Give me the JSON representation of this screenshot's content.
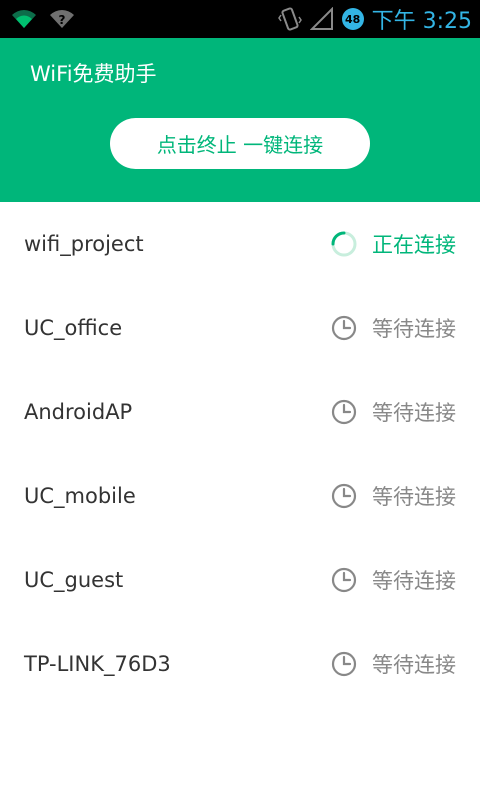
{
  "status_bar": {
    "time": "下午 3:25",
    "battery_level": "48",
    "icons": [
      "wifi-icon",
      "wifi-question-icon",
      "vibrate-icon",
      "signal-icon",
      "battery-icon"
    ]
  },
  "header": {
    "title": "WiFi免费助手",
    "button_label": "点击终止 一键连接"
  },
  "networks": [
    {
      "ssid": "wifi_project",
      "status": "正在连接",
      "state": "connecting"
    },
    {
      "ssid": "UC_office",
      "status": "等待连接",
      "state": "waiting"
    },
    {
      "ssid": "AndroidAP",
      "status": "等待连接",
      "state": "waiting"
    },
    {
      "ssid": "UC_mobile",
      "status": "等待连接",
      "state": "waiting"
    },
    {
      "ssid": "UC_guest",
      "status": "等待连接",
      "state": "waiting"
    },
    {
      "ssid": "TP-LINK_76D3",
      "status": "等待连接",
      "state": "waiting"
    }
  ],
  "colors": {
    "accent": "#00b67a",
    "status_bar": "#000000",
    "status_bar_text": "#33b5e5",
    "waiting_text": "#888888"
  }
}
